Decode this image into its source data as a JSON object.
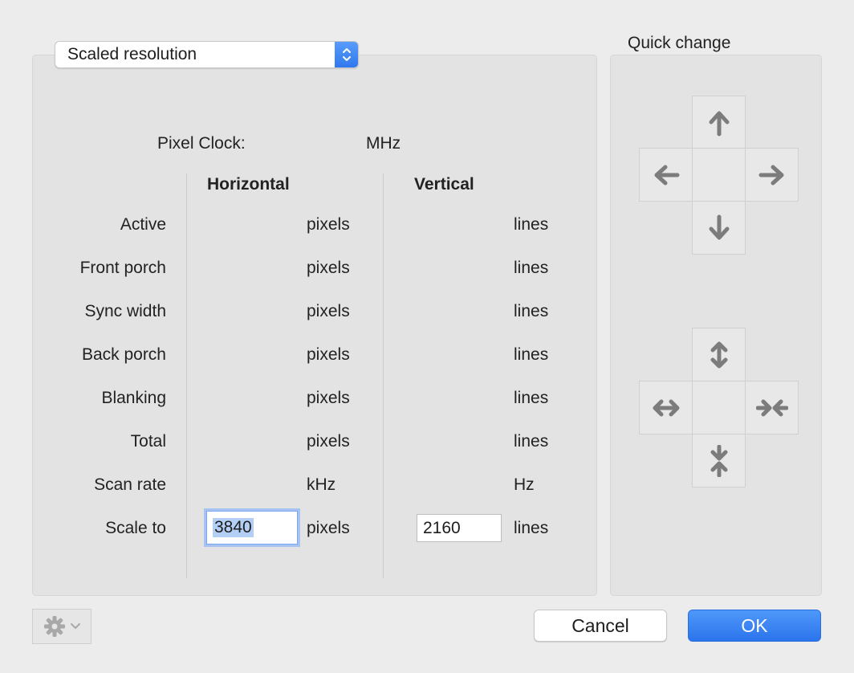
{
  "resolution_popup": {
    "value": "Scaled resolution"
  },
  "quick_change": {
    "title": "Quick change"
  },
  "pixel_clock": {
    "label": "Pixel Clock:",
    "unit": "MHz"
  },
  "columns": {
    "horizontal": "Horizontal",
    "vertical": "Vertical"
  },
  "rows": [
    {
      "label": "Active",
      "h_unit": "pixels",
      "v_unit": "lines"
    },
    {
      "label": "Front porch",
      "h_unit": "pixels",
      "v_unit": "lines"
    },
    {
      "label": "Sync width",
      "h_unit": "pixels",
      "v_unit": "lines"
    },
    {
      "label": "Back porch",
      "h_unit": "pixels",
      "v_unit": "lines"
    },
    {
      "label": "Blanking",
      "h_unit": "pixels",
      "v_unit": "lines"
    },
    {
      "label": "Total",
      "h_unit": "pixels",
      "v_unit": "lines"
    },
    {
      "label": "Scan rate",
      "h_unit": "kHz",
      "v_unit": "Hz"
    },
    {
      "label": "Scale to",
      "h_unit": "pixels",
      "v_unit": "lines"
    }
  ],
  "scale_to": {
    "horizontal_value": "3840",
    "vertical_value": "2160"
  },
  "buttons": {
    "cancel": "Cancel",
    "ok": "OK"
  },
  "icons": {
    "gear": "gear-icon",
    "arrow_up": "arrow-up-icon",
    "arrow_down": "arrow-down-icon",
    "arrow_left": "arrow-left-icon",
    "arrow_right": "arrow-right-icon",
    "expand_vertical": "expand-vertical-icon",
    "shrink_vertical": "shrink-vertical-icon",
    "expand_horizontal": "expand-horizontal-icon",
    "shrink_horizontal": "shrink-horizontal-icon"
  },
  "colors": {
    "accent": "#3b82f6",
    "background": "#ececec",
    "group_box": "#e3e3e3"
  }
}
